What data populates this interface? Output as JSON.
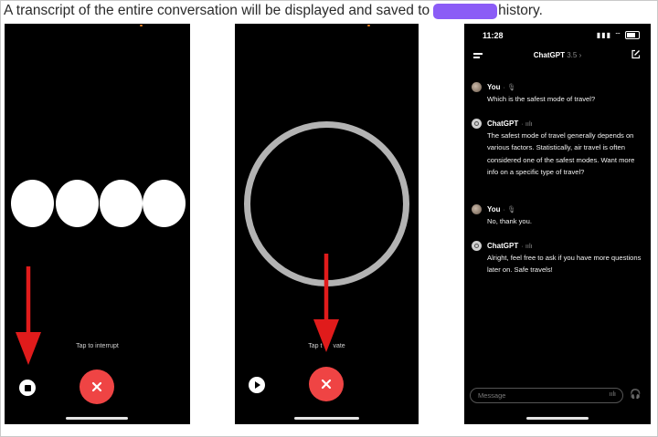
{
  "caption": {
    "before": "A transcript of the entire conversation will be displayed and saved to",
    "after": "history."
  },
  "colors": {
    "redaction": "#8b5cf6",
    "close_button": "#ef4444",
    "arrow": "#e01b1b",
    "ring": "#b3b3b3"
  },
  "panel1": {
    "hint": "Tap to interrupt",
    "icons": [
      "stop-icon",
      "close-icon"
    ]
  },
  "panel2": {
    "hint": "Tap to activate",
    "hint_visible_left": "Tap t",
    "hint_visible_right": "vate",
    "icons": [
      "play-icon",
      "close-icon"
    ]
  },
  "panel3": {
    "time": "11:28",
    "app_title": "ChatGPT",
    "model_version": "3.5",
    "messages": [
      {
        "sender": "You",
        "text": "Which is the safest mode of travel?"
      },
      {
        "sender": "ChatGPT",
        "text": "The safest mode of travel generally depends on various factors. Statistically, air travel is often considered one of the safest modes. Want more info on a specific type of travel?"
      },
      {
        "sender": "You",
        "text": "No, thank you."
      },
      {
        "sender": "ChatGPT",
        "text": "Alright, feel free to ask if you have more questions later on. Safe travels!"
      }
    ],
    "composer_placeholder": "Message"
  }
}
